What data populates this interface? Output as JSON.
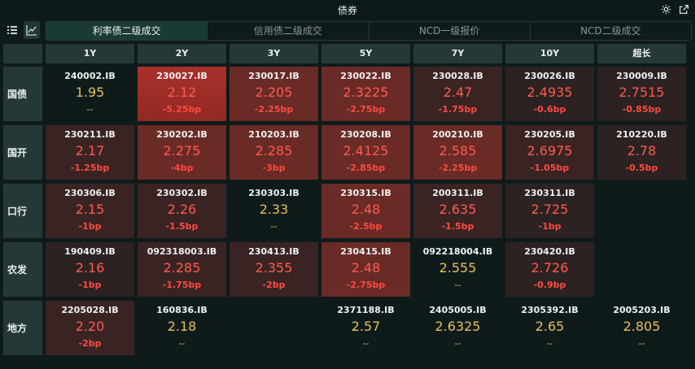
{
  "window": {
    "title": "债券"
  },
  "tabs": [
    {
      "label": "利率债二级成交",
      "active": true
    },
    {
      "label": "信用债二级成交",
      "active": false
    },
    {
      "label": "NCD一级报价",
      "active": false
    },
    {
      "label": "NCD二级成交",
      "active": false
    }
  ],
  "columns": [
    "1Y",
    "2Y",
    "3Y",
    "5Y",
    "7Y",
    "10Y",
    "超长"
  ],
  "rows": [
    {
      "label": "国债",
      "cells": [
        {
          "code": "240002.IB",
          "yield": "1.95",
          "change": "--",
          "tone": "none",
          "yc": "yellow"
        },
        {
          "code": "230027.IB",
          "yield": "2.12",
          "change": "-5.25bp",
          "tone": "strong",
          "yc": "red"
        },
        {
          "code": "230017.IB",
          "yield": "2.205",
          "change": "-2.25bp",
          "tone": "med",
          "yc": "red"
        },
        {
          "code": "230022.IB",
          "yield": "2.3225",
          "change": "-2.75bp",
          "tone": "med",
          "yc": "red"
        },
        {
          "code": "230028.IB",
          "yield": "2.47",
          "change": "-1.75bp",
          "tone": "light",
          "yc": "red"
        },
        {
          "code": "230026.IB",
          "yield": "2.4935",
          "change": "-0.6bp",
          "tone": "faint",
          "yc": "red"
        },
        {
          "code": "230009.IB",
          "yield": "2.7515",
          "change": "-0.85bp",
          "tone": "faint",
          "yc": "red"
        }
      ]
    },
    {
      "label": "国开",
      "cells": [
        {
          "code": "230211.IB",
          "yield": "2.17",
          "change": "-1.25bp",
          "tone": "light",
          "yc": "red"
        },
        {
          "code": "230202.IB",
          "yield": "2.275",
          "change": "-4bp",
          "tone": "med",
          "yc": "red"
        },
        {
          "code": "210203.IB",
          "yield": "2.285",
          "change": "-3bp",
          "tone": "med",
          "yc": "red"
        },
        {
          "code": "230208.IB",
          "yield": "2.4125",
          "change": "-2.85bp",
          "tone": "med",
          "yc": "red"
        },
        {
          "code": "200210.IB",
          "yield": "2.585",
          "change": "-2.25bp",
          "tone": "med",
          "yc": "red"
        },
        {
          "code": "230205.IB",
          "yield": "2.6975",
          "change": "-1.05bp",
          "tone": "light",
          "yc": "red"
        },
        {
          "code": "210220.IB",
          "yield": "2.78",
          "change": "-0.5bp",
          "tone": "faint",
          "yc": "red"
        }
      ]
    },
    {
      "label": "口行",
      "cells": [
        {
          "code": "230306.IB",
          "yield": "2.15",
          "change": "-1bp",
          "tone": "light",
          "yc": "red"
        },
        {
          "code": "230302.IB",
          "yield": "2.26",
          "change": "-1.5bp",
          "tone": "light",
          "yc": "red"
        },
        {
          "code": "230303.IB",
          "yield": "2.33",
          "change": "--",
          "tone": "none",
          "yc": "yellow"
        },
        {
          "code": "230315.IB",
          "yield": "2.48",
          "change": "-2.5bp",
          "tone": "med",
          "yc": "red"
        },
        {
          "code": "200311.IB",
          "yield": "2.635",
          "change": "-1.5bp",
          "tone": "light",
          "yc": "red"
        },
        {
          "code": "230311.IB",
          "yield": "2.725",
          "change": "-1bp",
          "tone": "faint",
          "yc": "red"
        },
        null
      ]
    },
    {
      "label": "农发",
      "cells": [
        {
          "code": "190409.IB",
          "yield": "2.16",
          "change": "-1bp",
          "tone": "faint",
          "yc": "red"
        },
        {
          "code": "092318003.IB",
          "yield": "2.285",
          "change": "-1.75bp",
          "tone": "light",
          "yc": "red"
        },
        {
          "code": "230413.IB",
          "yield": "2.355",
          "change": "-2bp",
          "tone": "light",
          "yc": "red"
        },
        {
          "code": "230415.IB",
          "yield": "2.48",
          "change": "-2.75bp",
          "tone": "med",
          "yc": "red"
        },
        {
          "code": "092218004.IB",
          "yield": "2.555",
          "change": "--",
          "tone": "none",
          "yc": "yellow"
        },
        {
          "code": "230420.IB",
          "yield": "2.726",
          "change": "-0.9bp",
          "tone": "faint",
          "yc": "red"
        },
        null
      ]
    },
    {
      "label": "地方",
      "cells": [
        {
          "code": "2205028.IB",
          "yield": "2.20",
          "change": "-2bp",
          "tone": "light",
          "yc": "red"
        },
        {
          "code": "160836.IB",
          "yield": "2.18",
          "change": "--",
          "tone": "none",
          "yc": "yellow"
        },
        null,
        {
          "code": "2371188.IB",
          "yield": "2.57",
          "change": "--",
          "tone": "none",
          "yc": "yellow"
        },
        {
          "code": "2405005.IB",
          "yield": "2.6325",
          "change": "--",
          "tone": "none",
          "yc": "yellow"
        },
        {
          "code": "2305392.IB",
          "yield": "2.65",
          "change": "--",
          "tone": "none",
          "yc": "yellow"
        },
        {
          "code": "2005203.IB",
          "yield": "2.805",
          "change": "--",
          "tone": "none",
          "yc": "yellow"
        }
      ]
    }
  ],
  "icons": {
    "settings": "gear-icon",
    "popout": "external-link-icon",
    "list_view": "list-icon",
    "chart_view": "line-chart-icon"
  }
}
